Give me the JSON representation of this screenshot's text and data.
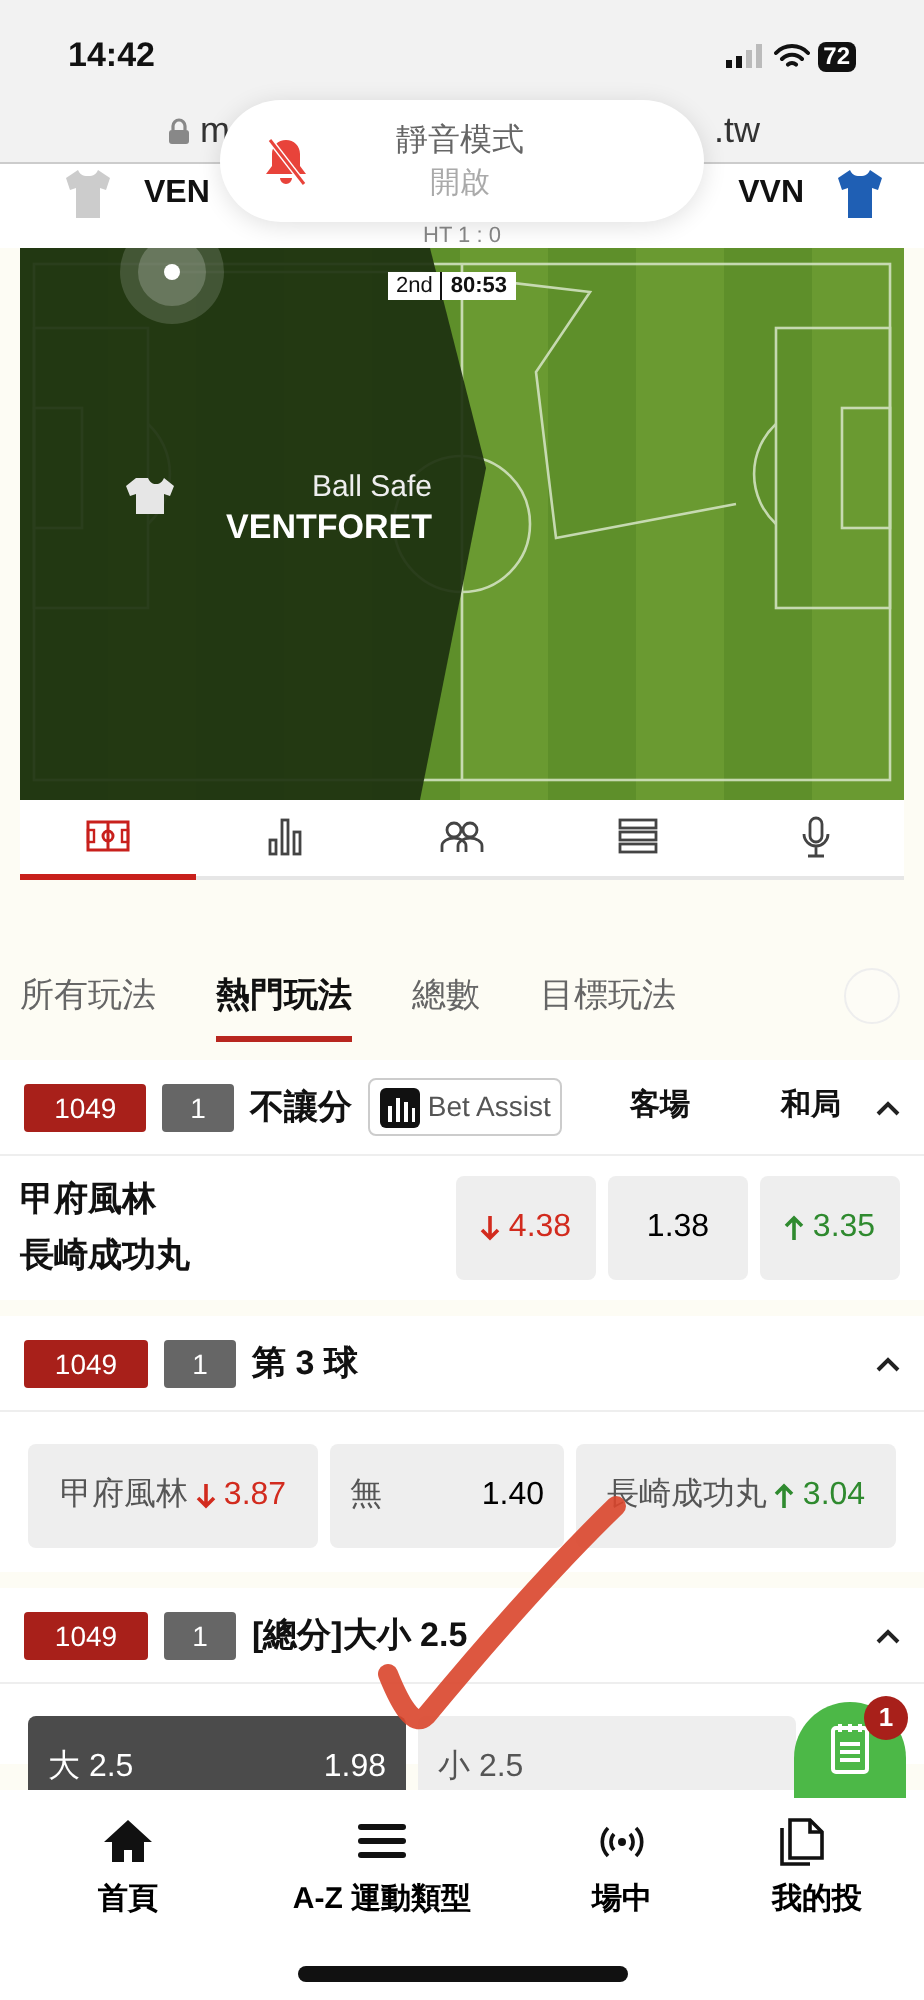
{
  "status_bar": {
    "time": "14:42",
    "battery": "72"
  },
  "url_bar": {
    "url_start": "m",
    "url_end": ".tw"
  },
  "toast": {
    "title": "靜音模式",
    "subtitle": "開啟"
  },
  "match": {
    "home": "VEN",
    "away": "VVN",
    "score": "HT 1 : 0"
  },
  "tracker": {
    "period": "2nd",
    "clock": "80:53",
    "status": "Ball Safe",
    "team": "VENTFORET"
  },
  "view_tabs": [
    {
      "kind": "pitch",
      "selected": true
    },
    {
      "kind": "stats",
      "selected": false
    },
    {
      "kind": "lineups",
      "selected": false
    },
    {
      "kind": "list",
      "selected": false
    },
    {
      "kind": "commentary",
      "selected": false
    }
  ],
  "market_tabs": [
    {
      "label": "所有玩法",
      "selected": false
    },
    {
      "label": "熱門玩法",
      "selected": true
    },
    {
      "label": "總數",
      "selected": false
    },
    {
      "label": "目標玩法",
      "selected": false
    }
  ],
  "markets": [
    {
      "kind": "teams",
      "event_id": "1049",
      "count": "1",
      "title": "不讓分",
      "bet_assist": "Bet Assist",
      "headers": [
        "客場",
        "和局"
      ],
      "expanded": true,
      "teams": [
        "甲府風林",
        "長崎成功丸"
      ],
      "odds": [
        {
          "value": "4.38",
          "kind": "down"
        },
        {
          "value": "1.38",
          "kind": "plain"
        },
        {
          "value": "3.35",
          "kind": "up"
        }
      ]
    },
    {
      "kind": "options",
      "event_id": "1049",
      "count": "1",
      "title": "第 3 球",
      "expanded": true,
      "options": [
        {
          "label": "甲府風林",
          "value": "3.87",
          "kind": "down",
          "selected": false
        },
        {
          "label": "無",
          "value": "1.40",
          "kind": "plain",
          "selected": false
        },
        {
          "label": "長崎成功丸",
          "value": "3.04",
          "kind": "up",
          "selected": false
        }
      ]
    },
    {
      "kind": "options",
      "event_id": "1049",
      "count": "1",
      "title": "[總分]大小 2.5",
      "expanded": true,
      "options": [
        {
          "label": "大 2.5",
          "value": "1.98",
          "selected": true
        },
        {
          "label": "小 2.5",
          "selected": false
        }
      ]
    }
  ],
  "bet_slip": {
    "count": "1"
  },
  "bottom_nav": [
    {
      "kind": "home",
      "label": "首頁"
    },
    {
      "kind": "menu",
      "label": "A-Z 運動類型"
    },
    {
      "kind": "live",
      "label": "場中"
    },
    {
      "kind": "pages",
      "label": "我的投"
    }
  ]
}
